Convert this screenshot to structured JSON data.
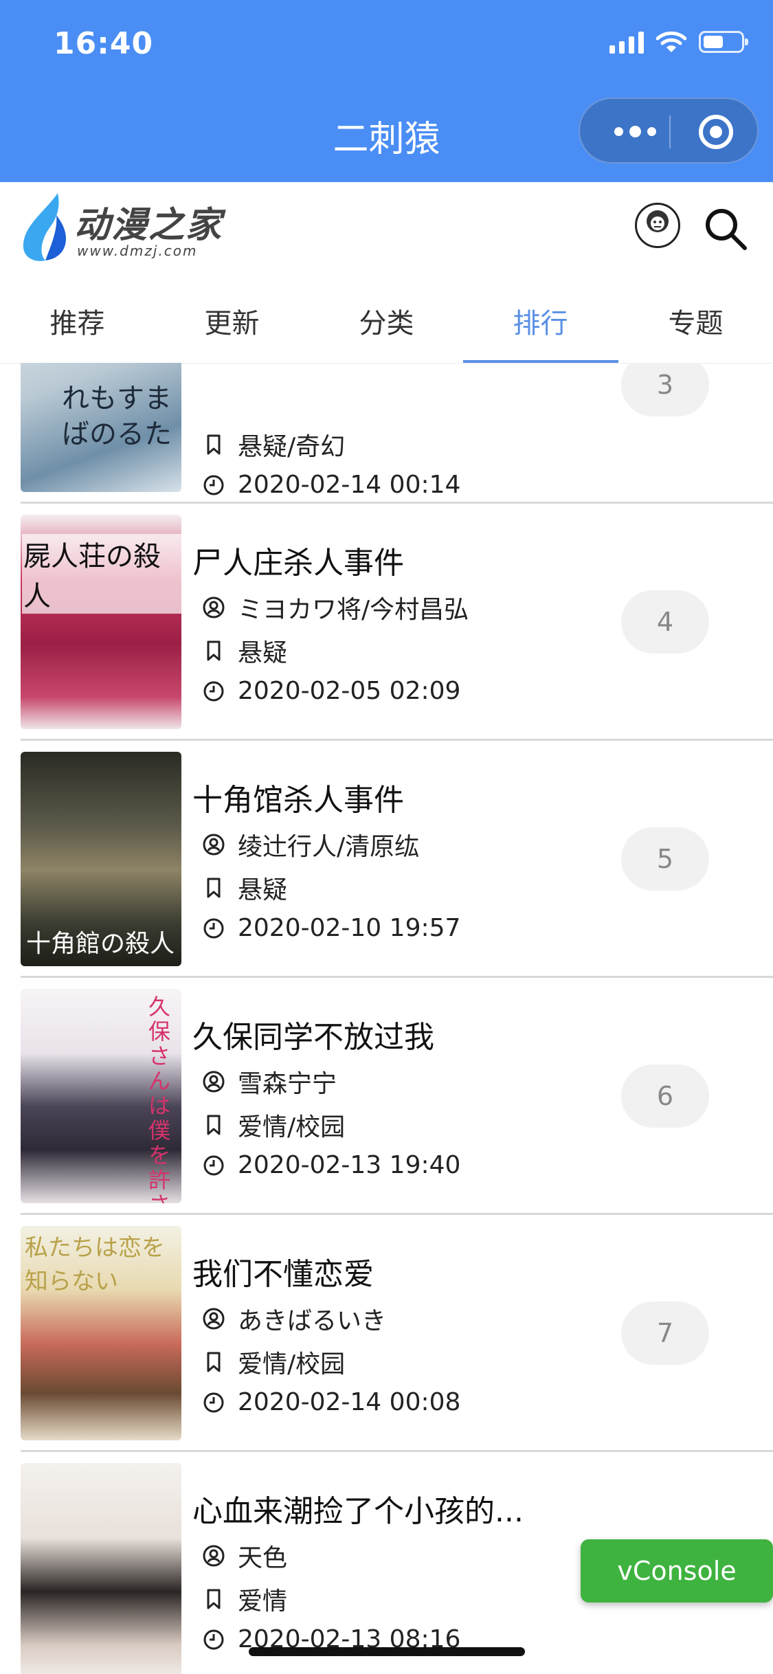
{
  "status_bar": {
    "time": "16:40"
  },
  "nav": {
    "title": "二刺猿"
  },
  "site": {
    "logo_cn": "动漫之家",
    "logo_en": "www.dmzj.com"
  },
  "tabs": [
    {
      "label": "推荐",
      "active": false
    },
    {
      "label": "更新",
      "active": false
    },
    {
      "label": "分类",
      "active": false
    },
    {
      "label": "排行",
      "active": true
    },
    {
      "label": "专题",
      "active": false
    }
  ],
  "items": [
    {
      "title": "",
      "author": "",
      "genre": "悬疑/奇幻",
      "date": "2020-02-14 00:14",
      "rank": "3",
      "cover_text": "れもすまばのるた"
    },
    {
      "title": "尸人庄杀人事件",
      "author": "ミヨカワ将/今村昌弘",
      "genre": "悬疑",
      "date": "2020-02-05 02:09",
      "rank": "4",
      "cover_text": "屍人荘の殺人"
    },
    {
      "title": "十角馆杀人事件",
      "author": "绫辻行人/清原纮",
      "genre": "悬疑",
      "date": "2020-02-10 19:57",
      "rank": "5",
      "cover_text": "十角館の殺人"
    },
    {
      "title": "久保同学不放过我",
      "author": "雪森宁宁",
      "genre": "爱情/校园",
      "date": "2020-02-13 19:40",
      "rank": "6",
      "cover_text": "久保さんは僕を許さない"
    },
    {
      "title": "我们不懂恋爱",
      "author": "あきばるいき",
      "genre": "爱情/校园",
      "date": "2020-02-14 00:08",
      "rank": "7",
      "cover_text": "私たちは恋を知らない"
    },
    {
      "title": "心血来潮捡了个小孩的...",
      "author": "天色",
      "genre": "爱情",
      "date": "2020-02-13 08:16",
      "rank": "",
      "cover_text": ""
    }
  ],
  "vconsole": {
    "label": "vConsole"
  },
  "colors": {
    "accent": "#4a8ef5",
    "tab_active": "#5a8fe6",
    "vconsole": "#3fb33f"
  }
}
